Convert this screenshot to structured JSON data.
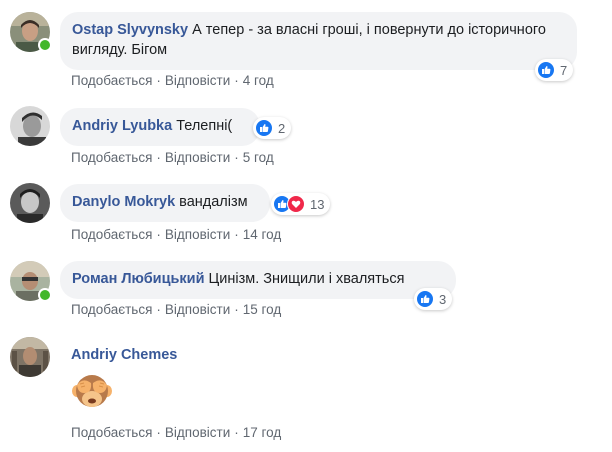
{
  "comments": [
    {
      "author": "Ostap Slyvynsky",
      "text": "А тепер - за власні гроші, і повернути до історичного вигляду. Бігом",
      "like_label": "Подобається",
      "reply_label": "Відповісти",
      "separator": "·",
      "time": "4 год",
      "reaction_count": "7",
      "reactions": [
        "like-icon"
      ],
      "online": true
    },
    {
      "author": "Andriy Lyubka",
      "text": "Телепні(",
      "like_label": "Подобається",
      "reply_label": "Відповісти",
      "separator": "·",
      "time": "5 год",
      "reaction_count": "2",
      "reactions": [
        "like-icon"
      ],
      "online": false
    },
    {
      "author": "Danylo Mokryk",
      "text": "вандалізм",
      "like_label": "Подобається",
      "reply_label": "Відповісти",
      "separator": "·",
      "time": "14 год",
      "reaction_count": "13",
      "reactions": [
        "like-icon",
        "love-icon"
      ],
      "online": false
    },
    {
      "author": "Роман Любицький",
      "text": "Цинізм. Знищили і хваляться",
      "like_label": "Подобається",
      "reply_label": "Відповісти",
      "separator": "·",
      "time": "15 год",
      "reaction_count": "3",
      "reactions": [
        "like-icon"
      ],
      "online": true
    },
    {
      "author": "Andriy Chemes",
      "text": "",
      "sticker": "see-no-evil-monkey-emoji",
      "like_label": "Подобається",
      "reply_label": "Відповісти",
      "separator": "·",
      "time": "17 год",
      "online": false
    }
  ],
  "colors": {
    "author": "#385898",
    "bubble": "#f2f3f5",
    "meta": "#606770",
    "like": "#1877f2",
    "love": "#f0284a",
    "online": "#42b72a"
  }
}
